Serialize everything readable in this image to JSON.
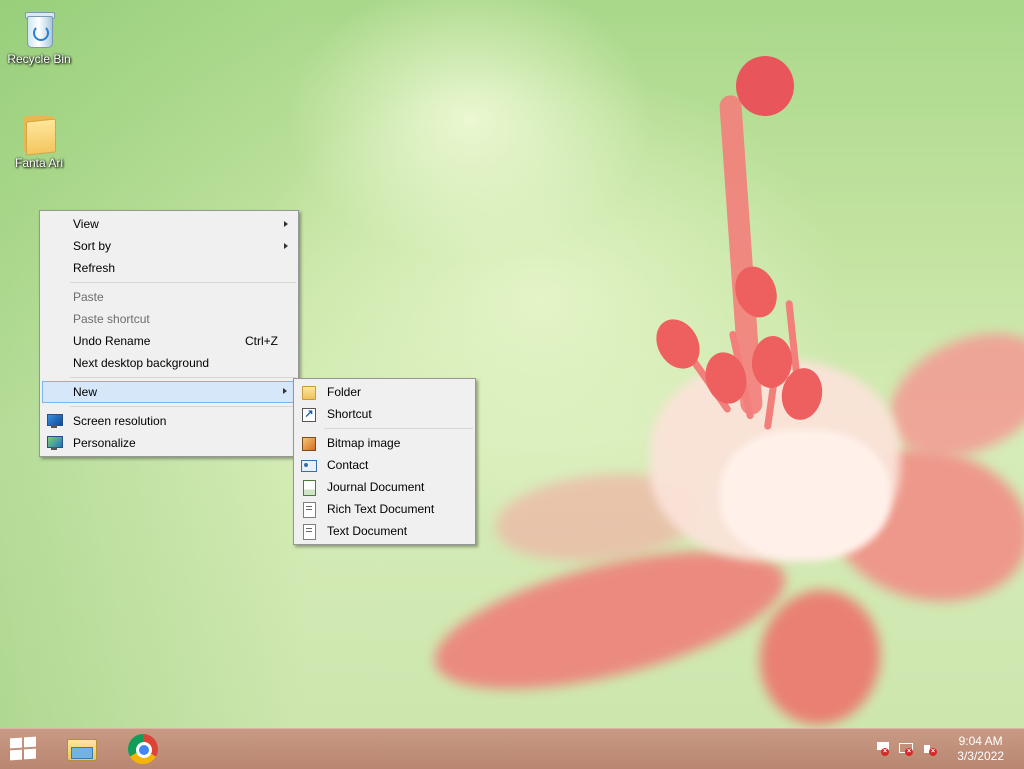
{
  "desktop": {
    "icons": [
      {
        "label": "Recycle Bin",
        "icon": "recycle-bin-icon"
      },
      {
        "label": "Fanta Ari",
        "icon": "folder-icon"
      }
    ]
  },
  "context_menu": {
    "items": {
      "view": {
        "label": "View",
        "submenu": true
      },
      "sort_by": {
        "label": "Sort by",
        "submenu": true
      },
      "refresh": {
        "label": "Refresh"
      },
      "paste": {
        "label": "Paste",
        "disabled": true
      },
      "paste_shortcut": {
        "label": "Paste shortcut",
        "disabled": true
      },
      "undo_rename": {
        "label": "Undo Rename",
        "shortcut": "Ctrl+Z"
      },
      "next_background": {
        "label": "Next desktop background"
      },
      "new": {
        "label": "New",
        "submenu": true,
        "highlighted": true
      },
      "screen_resolution": {
        "label": "Screen resolution",
        "icon": "monitor-icon"
      },
      "personalize": {
        "label": "Personalize",
        "icon": "personalize-icon"
      }
    }
  },
  "new_submenu": {
    "items": {
      "folder": {
        "label": "Folder",
        "icon": "folder-icon"
      },
      "shortcut": {
        "label": "Shortcut",
        "icon": "shortcut-icon"
      },
      "bitmap": {
        "label": "Bitmap image",
        "icon": "bitmap-icon"
      },
      "contact": {
        "label": "Contact",
        "icon": "contact-icon"
      },
      "journal": {
        "label": "Journal Document",
        "icon": "journal-icon"
      },
      "rich_text": {
        "label": "Rich Text Document",
        "icon": "rich-text-icon"
      },
      "text": {
        "label": "Text Document",
        "icon": "text-document-icon"
      }
    }
  },
  "taskbar": {
    "pinned": [
      "file-explorer-icon",
      "chrome-icon"
    ],
    "tray_icons": [
      "action-center-flag-icon",
      "network-icon",
      "volume-muted-icon"
    ],
    "clock": {
      "time": "9:04 AM",
      "date": "3/3/2022"
    }
  },
  "colors": {
    "menu_bg": "#f0f0f0",
    "menu_highlight": "#d5e7f8",
    "taskbar": "#c2917c",
    "petal": "#f07b76"
  }
}
